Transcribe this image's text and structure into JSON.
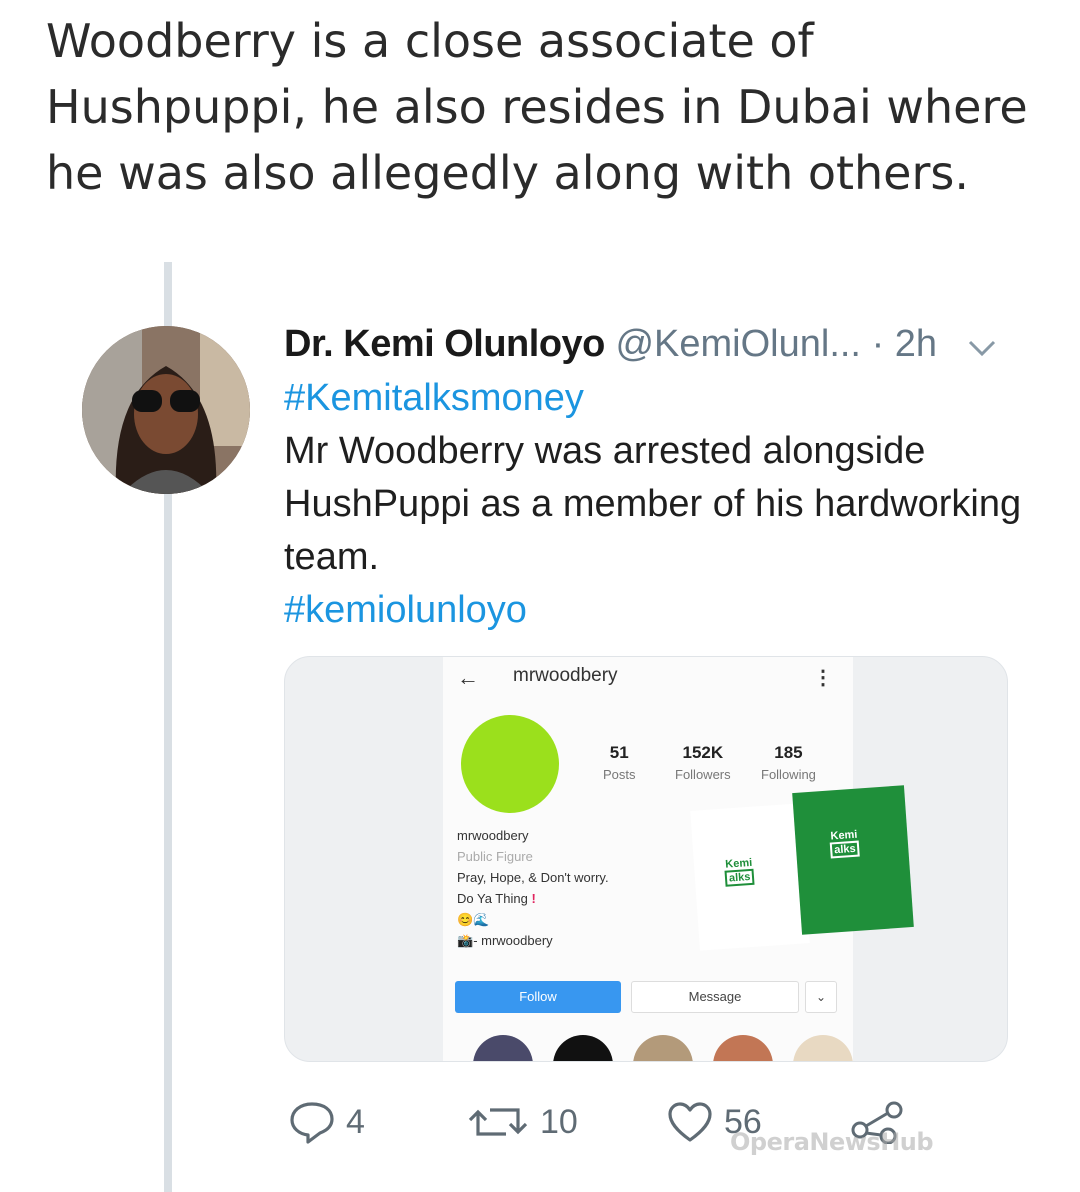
{
  "headline": "Woodberry is a close associate of Hushpuppi, he also resides in Dubai where he was also allegedly along with others.",
  "tweet": {
    "name": "Dr. Kemi Olunloyo",
    "handle": "@KemiOlunl...",
    "time": "· 2h",
    "hashtag1": "#Kemitalksmoney",
    "body": "Mr Woodberry was arrested alongside HushPuppi as a member of his hardworking team.",
    "hashtag2": "#kemiolunloyo",
    "colors": {
      "link": "#1b95e0",
      "muted": "#657786"
    }
  },
  "embedded_profile": {
    "username": "mrwoodbery",
    "stats": [
      {
        "value": "51",
        "label": "Posts"
      },
      {
        "value": "152K",
        "label": "Followers"
      },
      {
        "value": "185",
        "label": "Following"
      }
    ],
    "bio_name": "mrwoodbery",
    "category": "Public Figure",
    "bio_line1": "Pray, Hope, & Don't worry.",
    "bio_line2": "Do Ya Thing",
    "bio_mark": "!",
    "bio_emoji": "😊🌊",
    "bio_link": "mrwoodbery",
    "follow_label": "Follow",
    "message_label": "Message",
    "card_text_1": "Kemi",
    "card_text_2": "alks"
  },
  "actions": {
    "reply_count": "4",
    "retweet_count": "10",
    "like_count": "56"
  },
  "watermark": "OperaNewsHub"
}
